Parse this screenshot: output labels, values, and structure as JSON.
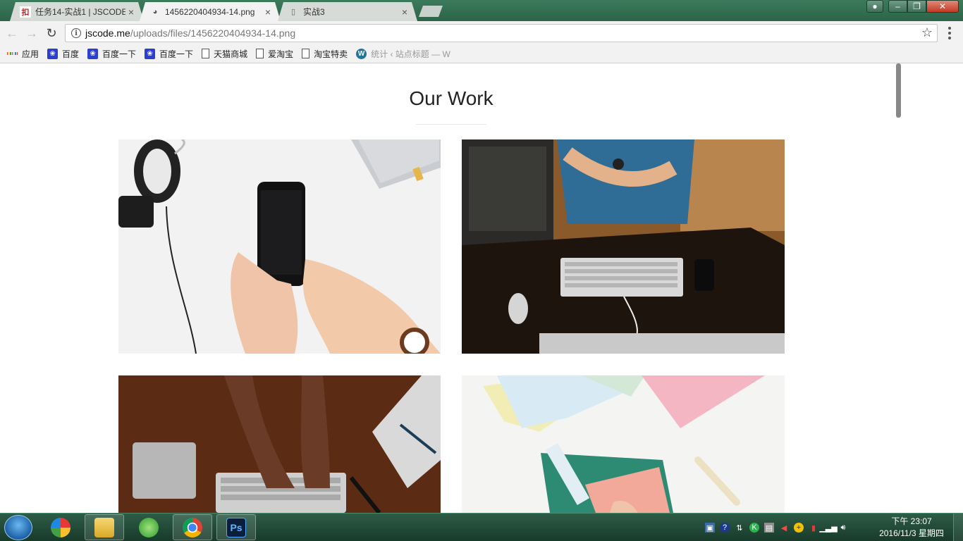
{
  "window": {
    "tabs": [
      {
        "label": "任务14-实战1 | JSCODE",
        "icon": "jscode-favicon",
        "active": false
      },
      {
        "label": "1456220404934-14.png",
        "icon": "image-favicon",
        "active": true
      },
      {
        "label": "实战3",
        "icon": "page-favicon",
        "active": false
      }
    ],
    "close_glyph": "×"
  },
  "toolbar": {
    "url_host": "jscode.me",
    "url_path": "/uploads/files/1456220404934-14.png"
  },
  "bookmarks": [
    {
      "label": "应用",
      "icon": "apps-icon"
    },
    {
      "label": "百度",
      "icon": "baidu-icon"
    },
    {
      "label": "百度一下",
      "icon": "baidu-icon"
    },
    {
      "label": "百度一下",
      "icon": "baidu-icon"
    },
    {
      "label": "天猫商城",
      "icon": "page-icon"
    },
    {
      "label": "爱淘宝",
      "icon": "page-icon"
    },
    {
      "label": "淘宝特卖",
      "icon": "page-icon"
    },
    {
      "label": "统计 ‹ 站点标题 — W",
      "icon": "wordpress-icon"
    }
  ],
  "page": {
    "title": "Our Work",
    "works": [
      {
        "name": "hands holding smartphone with headphones",
        "accent": "#f3f3f3"
      },
      {
        "name": "person at desk with keyboard and mouse",
        "accent": "#8c5a2e"
      },
      {
        "name": "hands typing on keyboard on wooden table",
        "accent": "#5a2a12"
      },
      {
        "name": "colored paper, ruler and cutting mat",
        "accent": "#f4f4f2"
      }
    ]
  },
  "taskbar": {
    "apps": [
      {
        "name": "file-explorer-icon"
      },
      {
        "name": "browser-360-icon"
      },
      {
        "name": "chrome-icon"
      },
      {
        "name": "photoshop-icon",
        "text": "Ps"
      }
    ],
    "clock_time": "下午 23:07",
    "clock_date": "2016/11/3 星期四"
  },
  "colors": {
    "title_bar": "#2f6a4e",
    "page_background": "#ffffff"
  }
}
